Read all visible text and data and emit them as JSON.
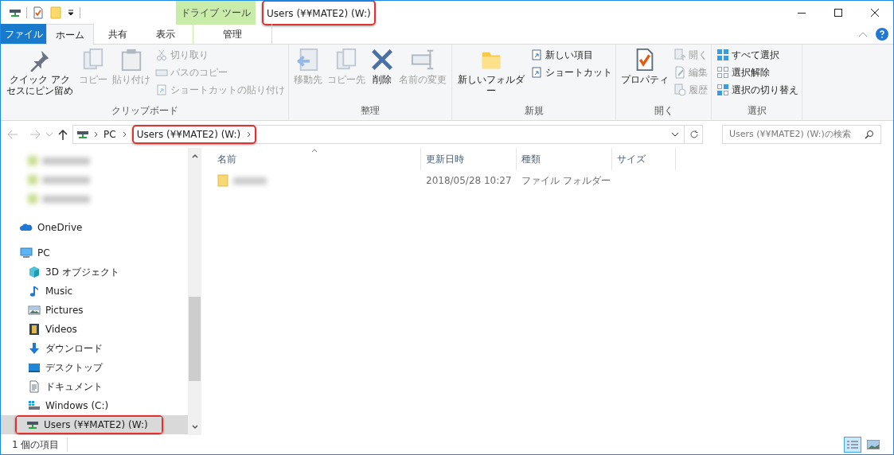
{
  "window": {
    "title": "Users (¥¥MATE2) (W:)",
    "context_tab_group": "ドライブ ツール"
  },
  "ribbon_tabs": [
    {
      "label": "ファイル",
      "kind": "file",
      "selected": false
    },
    {
      "label": "ホーム",
      "kind": "tab",
      "selected": true
    },
    {
      "label": "共有",
      "kind": "tab",
      "selected": false
    },
    {
      "label": "表示",
      "kind": "tab",
      "selected": false
    },
    {
      "label": "管理",
      "kind": "context",
      "selected": false
    }
  ],
  "ribbon_groups": [
    {
      "label": "クリップボード",
      "large": [
        {
          "label": "クイック アクセスにピン留め",
          "disabled": false
        },
        {
          "label": "コピー",
          "disabled": true
        },
        {
          "label": "貼り付け",
          "disabled": true
        }
      ],
      "small": [
        {
          "label": "切り取り",
          "disabled": true
        },
        {
          "label": "パスのコピー",
          "disabled": true
        },
        {
          "label": "ショートカットの貼り付け",
          "disabled": true
        }
      ]
    },
    {
      "label": "整理",
      "large": [
        {
          "label": "移動先",
          "disabled": true
        },
        {
          "label": "コピー先",
          "disabled": true
        },
        {
          "label": "削除",
          "disabled": false
        },
        {
          "label": "名前の変更",
          "disabled": true
        }
      ]
    },
    {
      "label": "新規",
      "large": [
        {
          "label": "新しいフォルダー",
          "disabled": false
        }
      ],
      "small": [
        {
          "label": "新しい項目",
          "disabled": false
        },
        {
          "label": "ショートカット",
          "disabled": false
        }
      ]
    },
    {
      "label": "開く",
      "large": [
        {
          "label": "プロパティ",
          "disabled": false
        }
      ],
      "small": [
        {
          "label": "開く",
          "disabled": true
        },
        {
          "label": "編集",
          "disabled": true
        },
        {
          "label": "履歴",
          "disabled": true
        }
      ]
    },
    {
      "label": "選択",
      "small": [
        {
          "label": "すべて選択",
          "disabled": false
        },
        {
          "label": "選択解除",
          "disabled": false
        },
        {
          "label": "選択の切り替え",
          "disabled": false
        }
      ]
    }
  ],
  "address": {
    "crumbs": [
      "PC",
      "Users (¥¥MATE2) (W:)"
    ]
  },
  "search": {
    "placeholder": "Users (¥¥MATE2) (W:)の検索"
  },
  "sidebar": {
    "items": [
      {
        "label": "OneDrive",
        "selected": false
      },
      {
        "label": "PC",
        "selected": false,
        "children": [
          {
            "label": "3D オブジェクト",
            "selected": false
          },
          {
            "label": "Music",
            "selected": false
          },
          {
            "label": "Pictures",
            "selected": false
          },
          {
            "label": "Videos",
            "selected": false
          },
          {
            "label": "ダウンロード",
            "selected": false
          },
          {
            "label": "デスクトップ",
            "selected": false
          },
          {
            "label": "ドキュメント",
            "selected": false
          },
          {
            "label": "Windows (C:)",
            "selected": false
          },
          {
            "label": "Users (¥¥MATE2) (W:)",
            "selected": true
          }
        ]
      }
    ]
  },
  "table": {
    "columns": [
      "名前",
      "更新日時",
      "種類",
      "サイズ"
    ],
    "rows": [
      {
        "modified": "2018/05/28 10:27",
        "type": "ファイル フォルダー"
      }
    ]
  },
  "status_bar": {
    "count": "1 個の項目"
  }
}
